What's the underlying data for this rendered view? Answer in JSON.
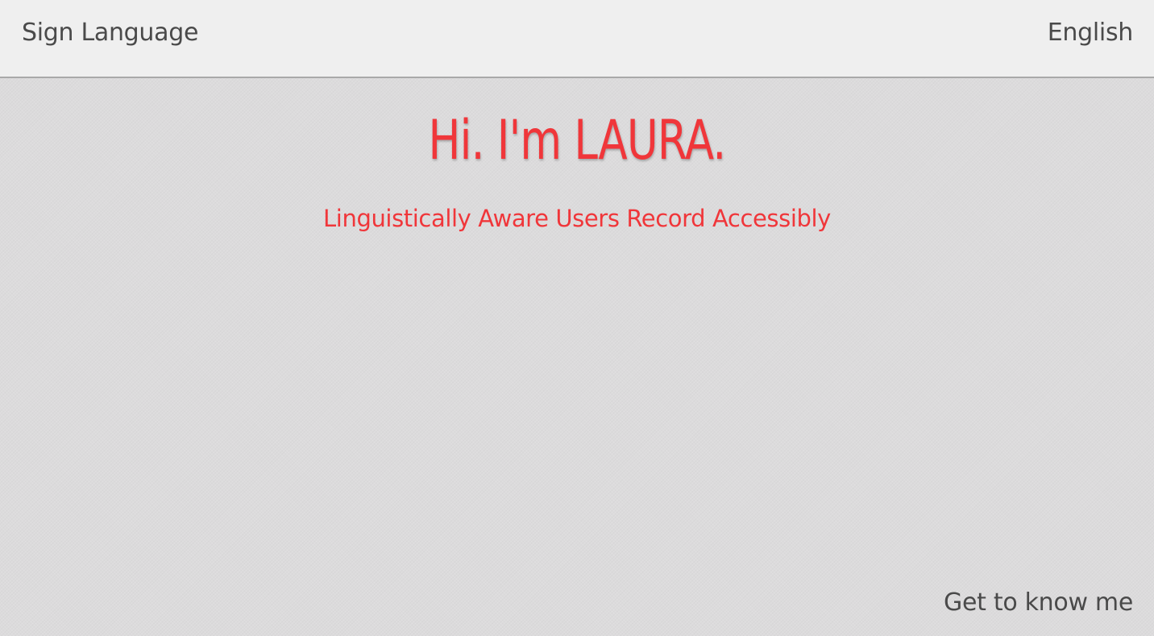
{
  "nav": {
    "left_label": "Sign Language",
    "right_label": "English"
  },
  "hero": {
    "title": "Hi. I'm LAURA.",
    "subtitle": "Linguistically Aware Users Record Accessibly"
  },
  "footer": {
    "link_label": "Get to know me"
  },
  "colors": {
    "accent": "#f0363a",
    "nav_text": "#4a4a4a",
    "topbar_bg": "#efefef",
    "page_bg": "#dcdbdc"
  }
}
